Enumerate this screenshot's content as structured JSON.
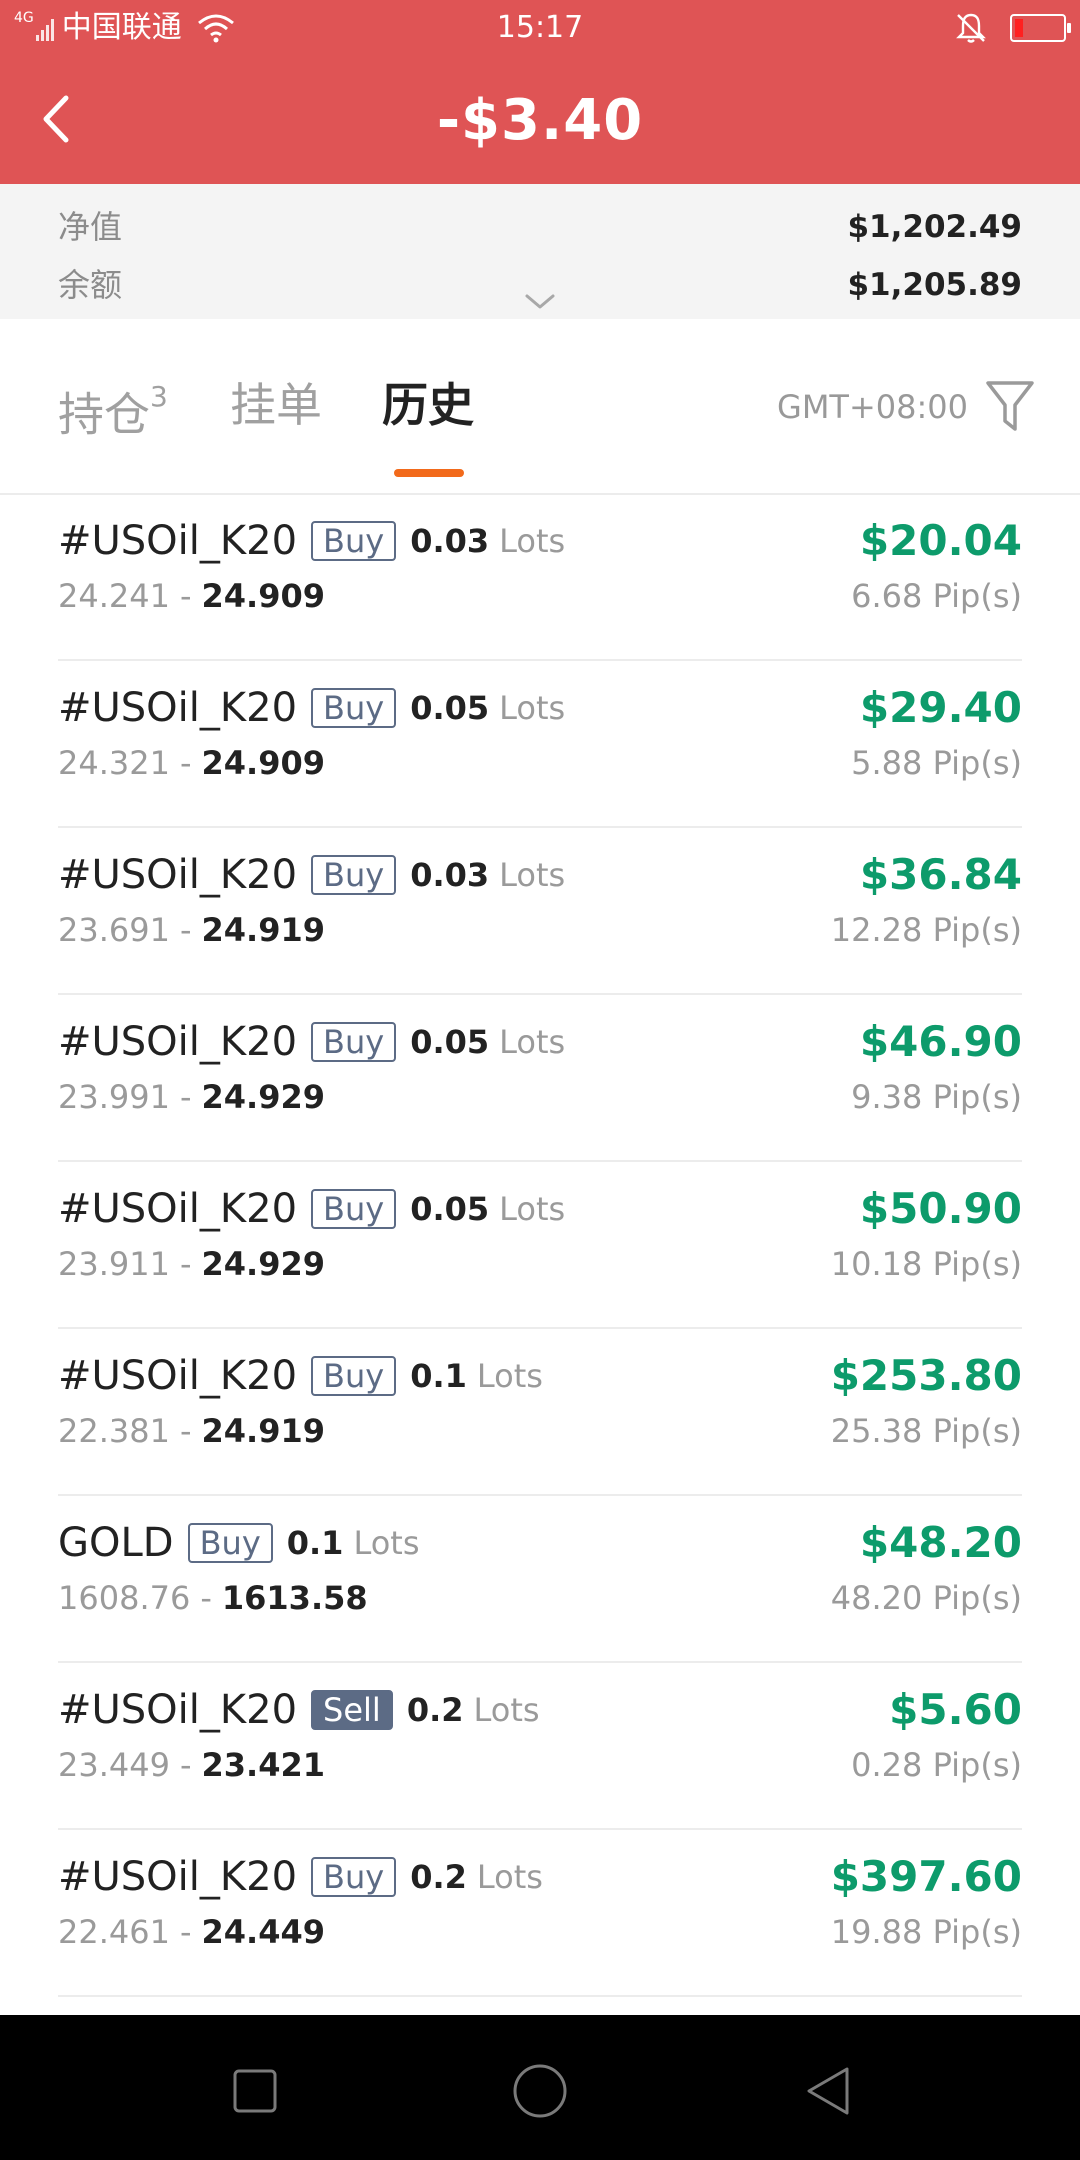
{
  "status_bar": {
    "network": "4G",
    "carrier": "中国联通",
    "time": "15:17",
    "icons": [
      "signal-icon",
      "wifi-icon",
      "bell-muted-icon",
      "battery-icon"
    ],
    "battery_level": 0.1
  },
  "header": {
    "title": "-$3.40",
    "background_color": "#df5455",
    "back_icon": "chevron-left-icon"
  },
  "summary": {
    "equity_label": "净值",
    "equity_value": "$1,202.49",
    "balance_label": "余额",
    "balance_value": "$1,205.89",
    "expand_icon": "chevron-down-icon"
  },
  "tabs": {
    "items": [
      {
        "label": "持仓",
        "badge": "3"
      },
      {
        "label": "挂单"
      },
      {
        "label": "历史"
      }
    ],
    "active": "历史",
    "accent_color": "#f26a1b",
    "timezone": "GMT+08:00",
    "filter_icon": "filter-icon"
  },
  "trades": [
    {
      "symbol": "#USOil_K20",
      "side": "Buy",
      "lots": "0.03",
      "lots_unit": "Lots",
      "open": "24.241",
      "separator": "-",
      "close": "24.909",
      "profit": "$20.04",
      "pips": "6.68 Pip(s)"
    },
    {
      "symbol": "#USOil_K20",
      "side": "Buy",
      "lots": "0.05",
      "lots_unit": "Lots",
      "open": "24.321",
      "separator": "-",
      "close": "24.909",
      "profit": "$29.40",
      "pips": "5.88 Pip(s)"
    },
    {
      "symbol": "#USOil_K20",
      "side": "Buy",
      "lots": "0.03",
      "lots_unit": "Lots",
      "open": "23.691",
      "separator": "-",
      "close": "24.919",
      "profit": "$36.84",
      "pips": "12.28 Pip(s)"
    },
    {
      "symbol": "#USOil_K20",
      "side": "Buy",
      "lots": "0.05",
      "lots_unit": "Lots",
      "open": "23.991",
      "separator": "-",
      "close": "24.929",
      "profit": "$46.90",
      "pips": "9.38 Pip(s)"
    },
    {
      "symbol": "#USOil_K20",
      "side": "Buy",
      "lots": "0.05",
      "lots_unit": "Lots",
      "open": "23.911",
      "separator": "-",
      "close": "24.929",
      "profit": "$50.90",
      "pips": "10.18 Pip(s)"
    },
    {
      "symbol": "#USOil_K20",
      "side": "Buy",
      "lots": "0.1",
      "lots_unit": "Lots",
      "open": "22.381",
      "separator": "-",
      "close": "24.919",
      "profit": "$253.80",
      "pips": "25.38 Pip(s)"
    },
    {
      "symbol": "GOLD",
      "side": "Buy",
      "lots": "0.1",
      "lots_unit": "Lots",
      "open": "1608.76",
      "separator": "-",
      "close": "1613.58",
      "profit": "$48.20",
      "pips": "48.20 Pip(s)"
    },
    {
      "symbol": "#USOil_K20",
      "side": "Sell",
      "lots": "0.2",
      "lots_unit": "Lots",
      "open": "23.449",
      "separator": "-",
      "close": "23.421",
      "profit": "$5.60",
      "pips": "0.28 Pip(s)"
    },
    {
      "symbol": "#USOil_K20",
      "side": "Buy",
      "lots": "0.2",
      "lots_unit": "Lots",
      "open": "22.461",
      "separator": "-",
      "close": "24.449",
      "profit": "$397.60",
      "pips": "19.88 Pip(s)"
    }
  ],
  "colors": {
    "profit": "#0d9b6b",
    "side_badge": "#5c6b85"
  },
  "nav_bar": {
    "icons": [
      "recents-square-icon",
      "home-circle-icon",
      "back-triangle-icon"
    ]
  }
}
